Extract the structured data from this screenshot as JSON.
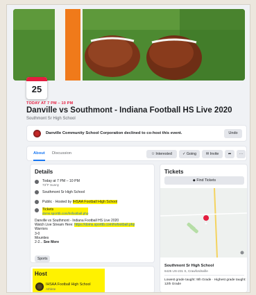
{
  "event": {
    "day": "25",
    "time_red": "TODAY AT 7 PM – 10 PM",
    "title": "Danville vs Southmont - Indiana Football HS Live 2020",
    "location_short": "Southmont Sr High School"
  },
  "cohost": {
    "message": "Danville Community School Corporation declined to co-host this event.",
    "undo": "Undo"
  },
  "tabs": [
    "About",
    "Discussion"
  ],
  "actions": {
    "interested": "Interested",
    "going": "Going",
    "invite": "Invite",
    "more": "···"
  },
  "details": {
    "heading": "Details",
    "time": "Today at 7 PM – 10 PM",
    "weather": "73°F Sunny",
    "location": "Southmont Sr High School",
    "public_prefix": "Public · Hosted by ",
    "host_name": "IHSAA Football High School",
    "tickets_label": "Tickets",
    "tickets_url": "doms.sporttb.com/hsfootball.php",
    "desc_line1": "Danville vs Southmont - Indiana Football HS Live 2020",
    "desc_line2_prefix": "Watch Live Stream Here: ",
    "desc_line2_url": "https://doms.sporttb.com/hsfootball.php",
    "desc_line3": "Warriors",
    "desc_line4": "3-0",
    "desc_line5": "Mounties",
    "desc_line6_prefix": "2-2... ",
    "see_more": "See More",
    "chip": "Sports"
  },
  "host": {
    "heading": "Host",
    "name": "IHSAA Football High School",
    "type": "Athlete"
  },
  "tickets": {
    "heading": "Tickets",
    "find": "Find Tickets",
    "venue": "Southmont Sr High School",
    "address": "6425 US-231 S, Crawfordsville",
    "grades": "Lowest grade taught: 9th Grade · Highest grade taught: 12th Grade"
  },
  "colors": {
    "accent": "#1877f2",
    "highlight": "#fff200",
    "date_red": "#e41e3f"
  }
}
